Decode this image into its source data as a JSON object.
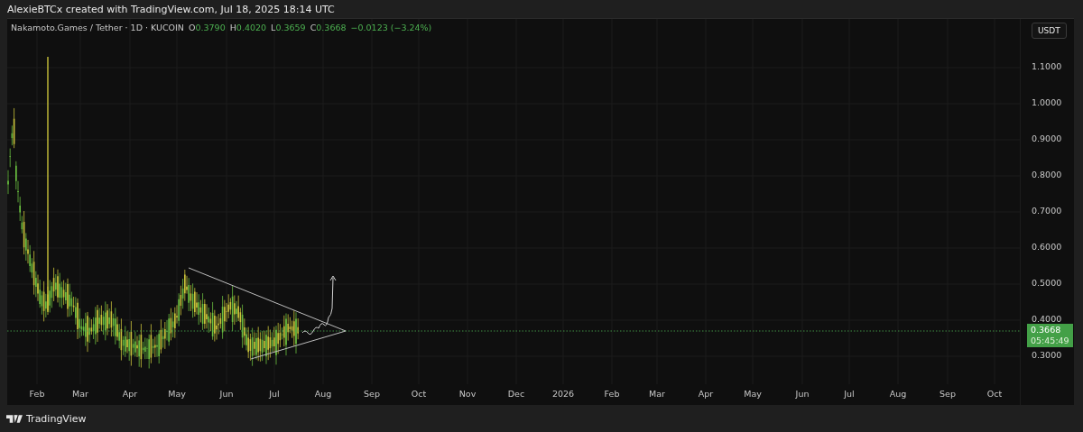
{
  "header": {
    "caption": "AlexieBTCx created with TradingView.com, Jul 18, 2025 18:14 UTC"
  },
  "legend": {
    "symbol": "Nakamoto.Games / Tether · 1D · KUCOIN",
    "ohlc": [
      {
        "label": "O",
        "value": "0.3790"
      },
      {
        "label": "H",
        "value": "0.4020"
      },
      {
        "label": "L",
        "value": "0.3659"
      },
      {
        "label": "C",
        "value": "0.3668"
      }
    ],
    "change": "−0.0123 (−3.24%)"
  },
  "price_axis": {
    "currency": "USDT",
    "labels": [
      "1.1000",
      "1.0000",
      "0.9000",
      "0.8000",
      "0.7000",
      "0.6000",
      "0.5000",
      "0.4000",
      "0.3000"
    ],
    "last_price": "0.3668",
    "countdown": "05:45:49"
  },
  "time_axis": {
    "labels": [
      "Feb",
      "Mar",
      "Apr",
      "May",
      "Jun",
      "Jul",
      "Aug",
      "Sep",
      "Oct",
      "Nov",
      "Dec",
      "2026",
      "Feb",
      "Mar",
      "Apr",
      "May",
      "Jun",
      "Jul",
      "Aug",
      "Sep",
      "Oct"
    ]
  },
  "footer": {
    "brand": "TradingView"
  }
}
